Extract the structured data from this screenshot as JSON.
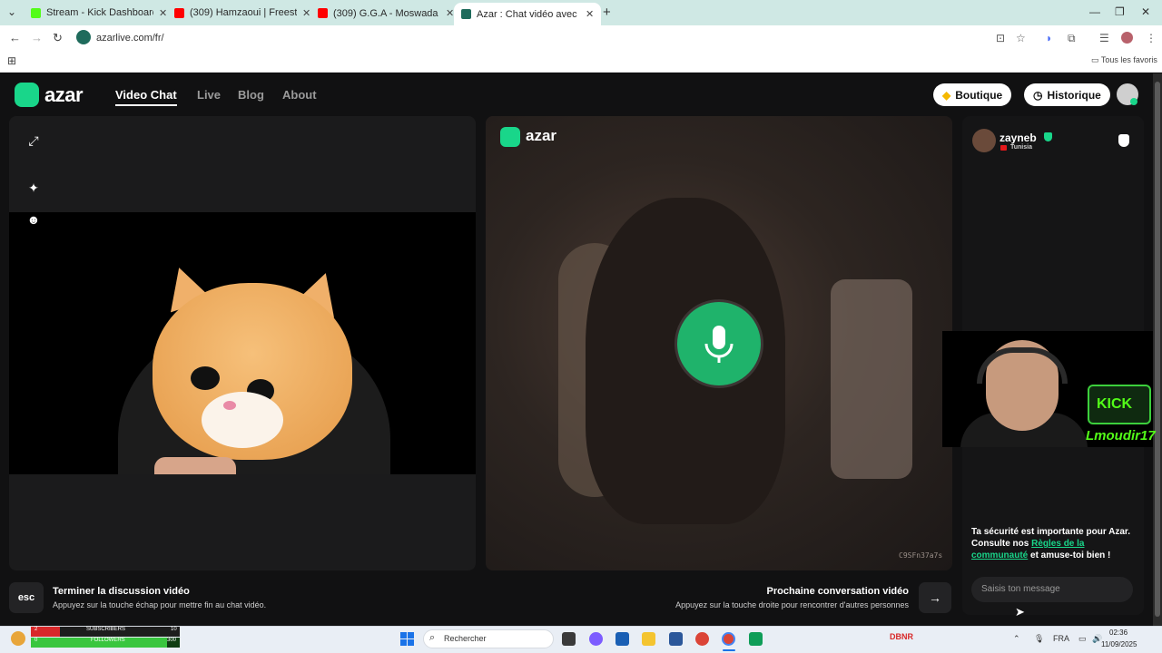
{
  "browser": {
    "tabs": [
      {
        "title": "Stream - Kick Dashboard",
        "color": "#53fc18"
      },
      {
        "title": "(309) Hamzaoui | Freestyle @Ra",
        "color": "#ff0000"
      },
      {
        "title": "(309) G.G.A - Moswada | مسودة",
        "color": "#ff0000"
      },
      {
        "title": "Azar : Chat vidéo avec de n",
        "color": "#1f6b5c"
      }
    ],
    "url": "azarlive.com/fr/",
    "bookmarks_all": "Tous les favoris"
  },
  "site": {
    "logo": "azar",
    "nav": [
      "Video Chat",
      "Live",
      "Blog",
      "About"
    ],
    "boutique": "Boutique",
    "historique": "Historique"
  },
  "partner_video": {
    "logo": "azar",
    "code": "C9SFn37a7s"
  },
  "chat": {
    "partner_name": "zayneb",
    "partner_country": "Tunisia",
    "safety_prefix": "Ta sécurité est importante pour Azar. Consulte nos ",
    "safety_link": "Règles de la communauté",
    "safety_suffix": " et amuse-toi bien !",
    "input_placeholder": "Saisis ton message"
  },
  "overlay": {
    "kick_logo": "KICK",
    "handle": "Lmoudir17"
  },
  "controls": {
    "esc_key": "esc",
    "end_title": "Terminer la discussion vidéo",
    "end_sub": "Appuyez sur la touche échap pour mettre fin au chat vidéo.",
    "next_title": "Prochaine conversation vidéo",
    "next_sub": "Appuyez sur la touche droite pour rencontrer d'autres personnes",
    "next_key_icon": "arrow-right-icon"
  },
  "taskbar": {
    "subscribers_label": "SUBSCRIBERS",
    "subscribers_count": "2",
    "subscribers_goal": "10",
    "followers_label": "FOLLOWERS",
    "followers_count": "0",
    "followers_goal": "300",
    "search_label": "Rechercher",
    "tray_app": "DBNR",
    "language": "FRA",
    "time": "02:36",
    "date": "11/09/2025"
  },
  "colors": {
    "accent": "#19d68a",
    "mic": "#1fb36b",
    "kick": "#53fc18"
  }
}
